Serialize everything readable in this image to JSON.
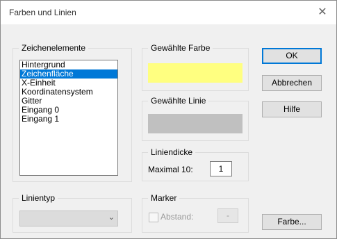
{
  "window": {
    "title": "Farben und Linien",
    "close_icon": "close-icon"
  },
  "elements_group": {
    "label": "Zeichenelemente",
    "items": [
      "Hintergrund",
      "Zeichenfläche",
      "X-Einheit",
      "Koordinatensystem",
      "Gitter",
      "Eingang  0",
      "Eingang  1"
    ],
    "selected_index": 1
  },
  "color_group": {
    "label": "Gewählte Farbe",
    "swatch_color": "#ffff80"
  },
  "line_group": {
    "label": "Gewählte Linie",
    "swatch_color": "#c0c0c0"
  },
  "thickness_group": {
    "label": "Liniendicke",
    "max_label": "Maximal 10:",
    "value": "1"
  },
  "linetype_group": {
    "label": "Linientyp",
    "selected_value": ""
  },
  "marker_group": {
    "label": "Marker",
    "distance_label": "Abstand:",
    "distance_value": "-"
  },
  "buttons": {
    "ok": "OK",
    "cancel": "Abbrechen",
    "help": "Hilfe",
    "color": "Farbe..."
  }
}
